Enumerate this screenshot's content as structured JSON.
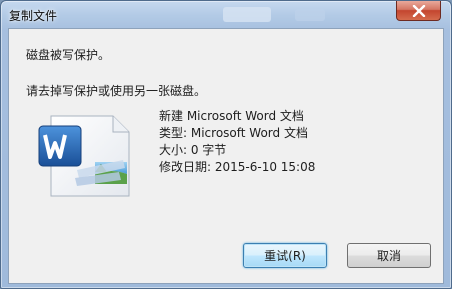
{
  "window": {
    "title": "复制文件"
  },
  "dialog": {
    "message": "磁盘被写保护。",
    "instruction": "请去掉写保护或使用另一张磁盘。"
  },
  "file": {
    "icon": "word-document-icon",
    "name": "新建 Microsoft Word 文档",
    "type": "类型: Microsoft Word 文档",
    "size": "大小: 0 字节",
    "modified": "修改日期: 2015-6-10 15:08"
  },
  "buttons": {
    "retry": "重试(R)",
    "cancel": "取消"
  },
  "colors": {
    "accent": "#3c7fb1",
    "close": "#c3452f",
    "word_blue": "#1f5fa8"
  }
}
